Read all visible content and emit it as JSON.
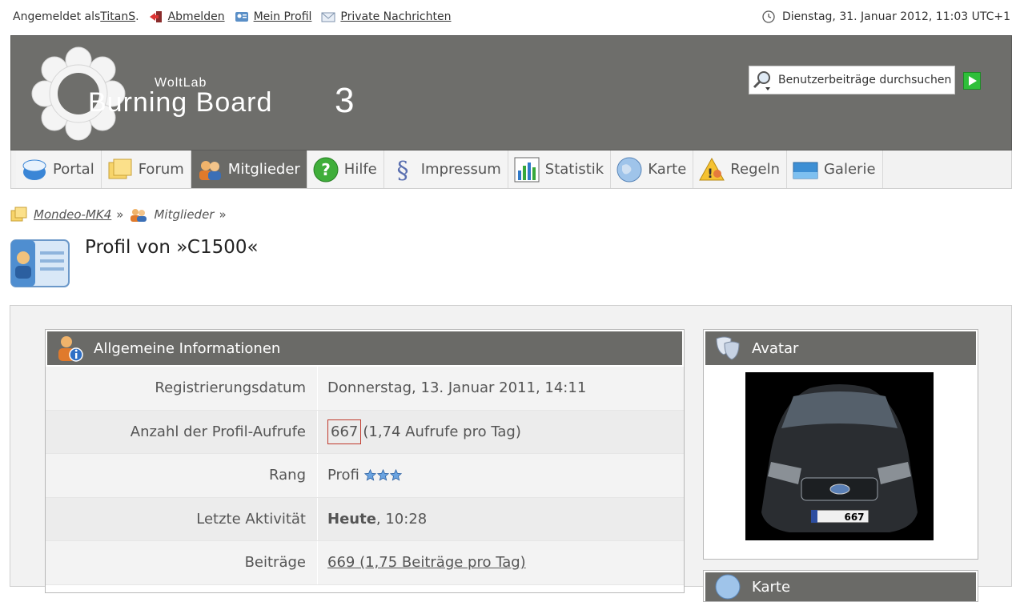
{
  "userbar": {
    "logged_in_prefix": "Angemeldet als ",
    "username": "TitanS",
    "suffix": ".",
    "logout": "Abmelden",
    "profile": "Mein Profil",
    "messages": "Private Nachrichten",
    "datetime": "Dienstag, 31. Januar 2012, 11:03 UTC+1"
  },
  "header": {
    "logo_small": "WoltLab",
    "logo_big": "Burning Board",
    "logo_num": "3",
    "search_value": "Benutzerbeiträge durchsuchen"
  },
  "nav": {
    "tabs": [
      {
        "label": "Portal",
        "icon": "portal-icon"
      },
      {
        "label": "Forum",
        "icon": "forum-icon"
      },
      {
        "label": "Mitglieder",
        "icon": "members-icon",
        "active": true
      },
      {
        "label": "Hilfe",
        "icon": "help-icon"
      },
      {
        "label": "Impressum",
        "icon": "imprint-icon"
      },
      {
        "label": "Statistik",
        "icon": "statistics-icon"
      },
      {
        "label": "Karte",
        "icon": "globe-icon"
      },
      {
        "label": "Regeln",
        "icon": "rules-icon"
      },
      {
        "label": "Galerie",
        "icon": "gallery-icon"
      }
    ]
  },
  "breadcrumb": {
    "home": "Mondeo-MK4",
    "sep1": "»",
    "members": "Mitglieder",
    "sep2": "»"
  },
  "page": {
    "title": "Profil von »C1500«"
  },
  "info": {
    "heading": "Allgemeine Informationen",
    "rows": [
      {
        "label": "Registrierungsdatum",
        "value": "Donnerstag, 13. Januar 2011, 14:11"
      },
      {
        "label": "Anzahl der Profil-Aufrufe",
        "value_boxed": "667",
        "value": "(1,74 Aufrufe pro Tag)"
      },
      {
        "label": "Rang",
        "value": "Profi"
      },
      {
        "label": "Letzte Aktivität",
        "value_bold": "Heute",
        "value": ", 10:28"
      },
      {
        "label": "Beiträge",
        "value": "669 (1,75 Beiträge pro Tag)"
      }
    ]
  },
  "avatar": {
    "heading": "Avatar",
    "plate": "667"
  },
  "karte": {
    "heading": "Karte"
  },
  "colors": {
    "header_bg": "#6e6e6b",
    "active_tab": "#6a6a67",
    "highlight_border": "#c0392b"
  }
}
